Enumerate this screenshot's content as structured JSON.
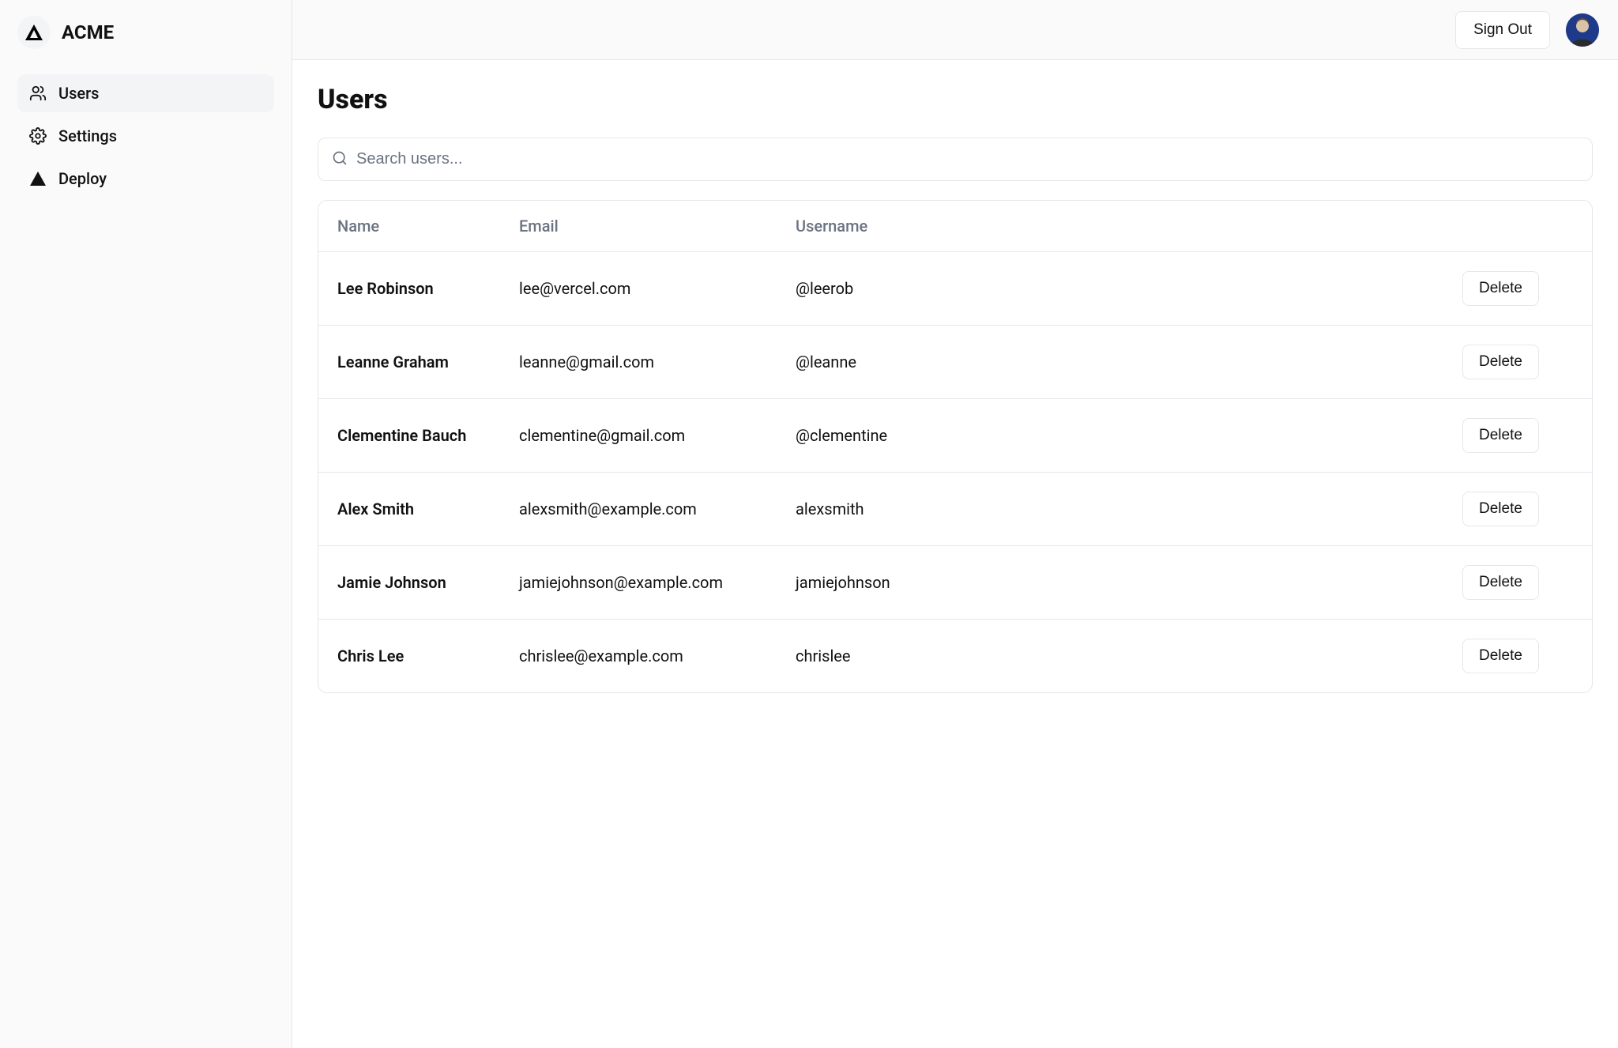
{
  "brand": "ACME",
  "sidebar": {
    "items": [
      {
        "label": "Users"
      },
      {
        "label": "Settings"
      },
      {
        "label": "Deploy"
      }
    ]
  },
  "header": {
    "signout": "Sign Out"
  },
  "page": {
    "title": "Users",
    "search_placeholder": "Search users..."
  },
  "table": {
    "columns": {
      "name": "Name",
      "email": "Email",
      "username": "Username"
    },
    "delete_label": "Delete",
    "rows": [
      {
        "name": "Lee Robinson",
        "email": "lee@vercel.com",
        "username": "@leerob"
      },
      {
        "name": "Leanne Graham",
        "email": "leanne@gmail.com",
        "username": "@leanne"
      },
      {
        "name": "Clementine Bauch",
        "email": "clementine@gmail.com",
        "username": "@clementine"
      },
      {
        "name": "Alex Smith",
        "email": "alexsmith@example.com",
        "username": "alexsmith"
      },
      {
        "name": "Jamie Johnson",
        "email": "jamiejohnson@example.com",
        "username": "jamiejohnson"
      },
      {
        "name": "Chris Lee",
        "email": "chrislee@example.com",
        "username": "chrislee"
      }
    ]
  }
}
